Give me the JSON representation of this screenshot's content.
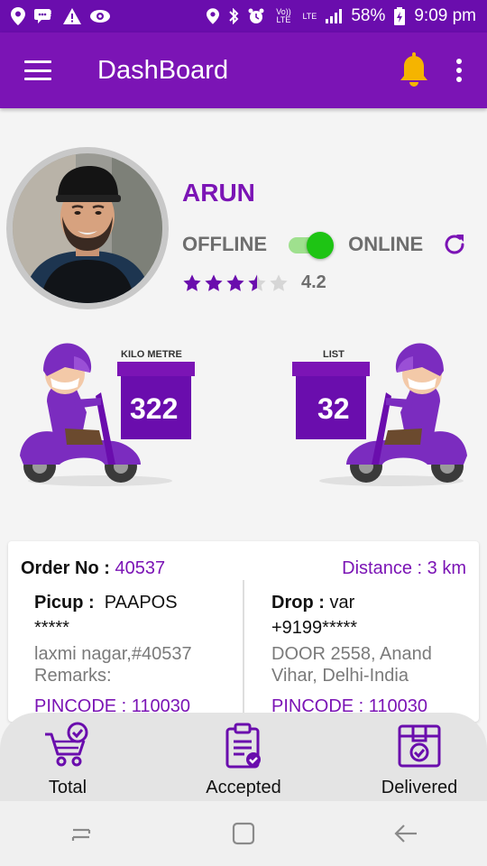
{
  "status_bar": {
    "battery": "58%",
    "time": "9:09 pm",
    "volte": "Vo)) LTE",
    "lte": "LTE"
  },
  "app_bar": {
    "title": "DashBoard"
  },
  "profile": {
    "name": "ARUN",
    "offline_label": "OFFLINE",
    "online_label": "ONLINE",
    "online": true,
    "rating": "4.2",
    "rating_value": 4.2
  },
  "stats": {
    "km_caption": "KILO METRE",
    "km_value": "322",
    "list_caption": "LIST",
    "list_value": "32"
  },
  "order": {
    "order_label": "Order No :",
    "order_no": "40537",
    "distance": "Distance : 3 km",
    "pickup": {
      "label": "Picup :",
      "name": "PAAPOS",
      "phone": "*****",
      "address": "laxmi nagar,#40537",
      "remarks": "Remarks:",
      "pincode": "PINCODE : 110030"
    },
    "drop": {
      "label": "Drop :",
      "name": "var",
      "phone": "+9199*****",
      "address": "DOOR 2558, Anand Vihar, Delhi-India",
      "pincode": "PINCODE : 110030"
    }
  },
  "tabs": {
    "total": "Total",
    "accepted": "Accepted",
    "delivered": "Delivered"
  },
  "colors": {
    "primary": "#7b14b5",
    "accent": "#f5b400",
    "toggle_on": "#1ec414"
  }
}
